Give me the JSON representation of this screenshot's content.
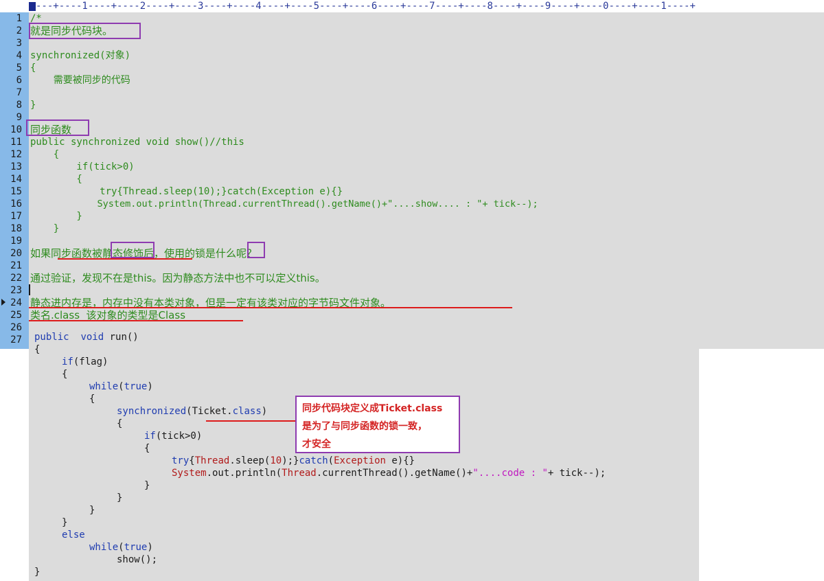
{
  "ruler": {
    "text": "---+----1----+----2----+----3----+----4----+----5----+----6----+----7----+----8----+----9----+----0----+----1----+"
  },
  "line_numbers": [
    "1",
    "2",
    "3",
    "4",
    "5",
    "6",
    "7",
    "8",
    "9",
    "10",
    "11",
    "12",
    "13",
    "14",
    "15",
    "16",
    "17",
    "18",
    "19",
    "20",
    "21",
    "22",
    "23",
    "24",
    "25",
    "26",
    "27"
  ],
  "top_lines": {
    "l1": "/*",
    "l2": "就是同步代码块。",
    "l4": "synchronized(对象)",
    "l5": "{",
    "l6": "    需要被同步的代码",
    "l8": "}",
    "l10": "同步函数",
    "l11": "public synchronized void show()//this",
    "l12": "    {",
    "l13": "        if(tick>0)",
    "l14": "        {",
    "l15": "            try{Thread.sleep(10);}catch(Exception e){}",
    "l16": "            System.out.println(Thread.currentThread().getName()+\"....show.... : \"+ tick--);",
    "l17": "        }",
    "l18": "    }",
    "l20": "如果同步函数被静态修饰后，使用的锁是什么呢？",
    "l22": "通过验证，发现不在是this。因为静态方法中也不可以定义this。",
    "l24": "静态进内存是，内存中没有本类对象，但是一定有该类对应的字节码文件对象。",
    "l25": "类名.class  该对象的类型是Class"
  },
  "run_code": {
    "public": "public",
    "void": "void",
    "run": "run()",
    "open_brace": "{",
    "if_kw": "if",
    "if_cond": "(flag)",
    "while_kw": "while",
    "true_kw": "true",
    "sync_kw": "synchronized",
    "ticket": "Ticket",
    "class_kw": "class",
    "tick_cond": "(tick>0)",
    "try_kw": "try",
    "thread": "Thread",
    "sleep": ".sleep(",
    "num10": "10",
    "catch_kw": "catch",
    "exception": "Exception",
    "e_var": "e){}",
    "system": "System",
    "println": ".out.println(",
    "current": ".currentThread().getName()+",
    "code_str": "\"....code : \"",
    "tick_dec": "+ tick--);",
    "else_kw": "else",
    "show_call": "show();",
    "close_brace": "}"
  },
  "annotation_note": {
    "line1": "同步代码块定义成Ticket.class",
    "line2": "是为了与同步函数的锁一致，",
    "line3": "才安全"
  },
  "colors": {
    "gutter": "#87b9e8",
    "editor_bg": "#dcdcdc",
    "comment_green": "#2e8b1e",
    "keyword_blue": "#1f3cb0",
    "highlight_box": "#8e3bb0",
    "underline_red": "#dd1b1b"
  }
}
